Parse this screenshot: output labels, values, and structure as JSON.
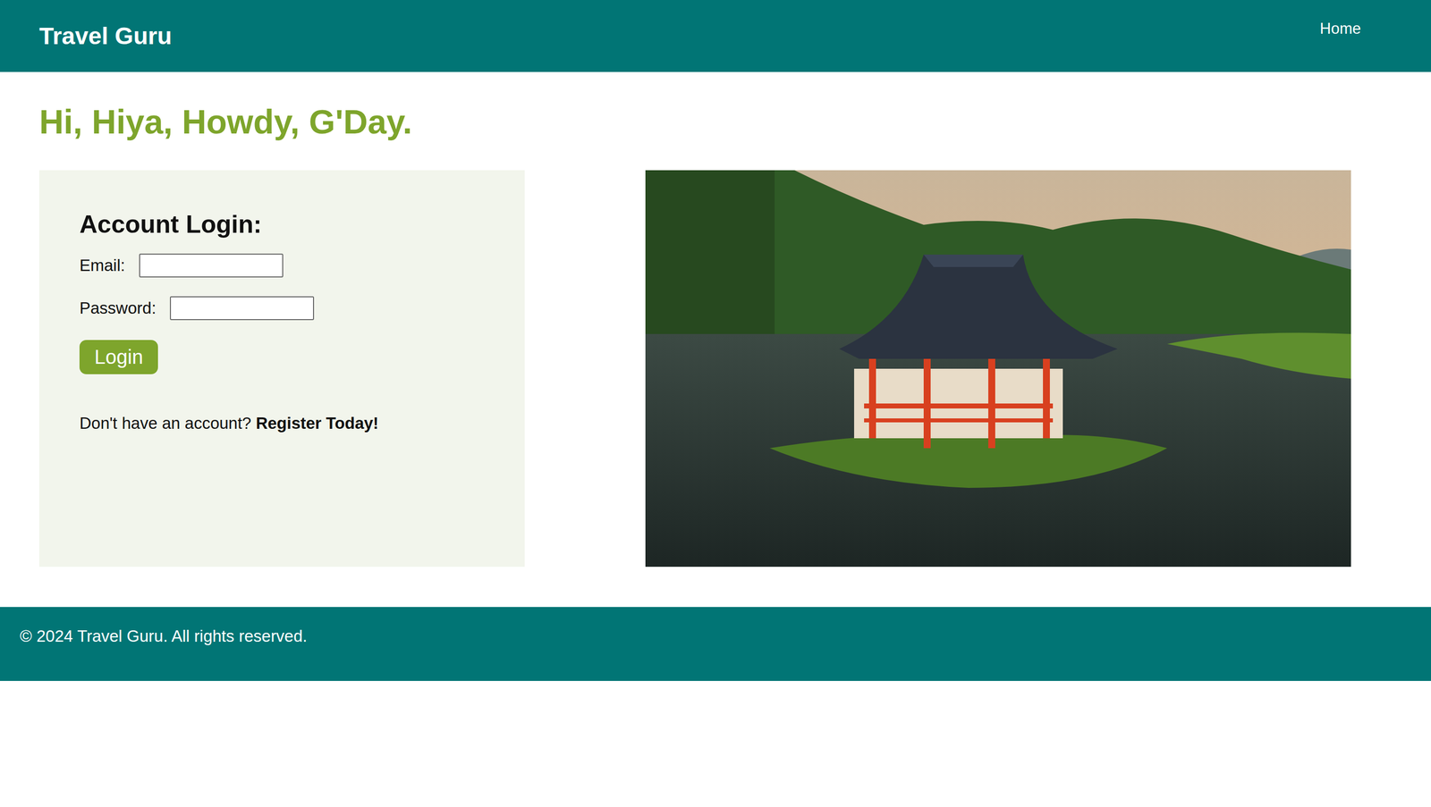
{
  "header": {
    "brand": "Travel Guru",
    "nav": [
      {
        "label": "Home"
      }
    ]
  },
  "greeting": "Hi, Hiya, Howdy, G'Day.",
  "login": {
    "title": "Account Login:",
    "fields": [
      {
        "label": "Email:"
      },
      {
        "label": "Password:"
      }
    ],
    "button": "Login",
    "register_prompt": "Don't have an account?",
    "register_link": "Register Today!"
  },
  "footer": "© 2024 Travel Guru. All rights reserved."
}
